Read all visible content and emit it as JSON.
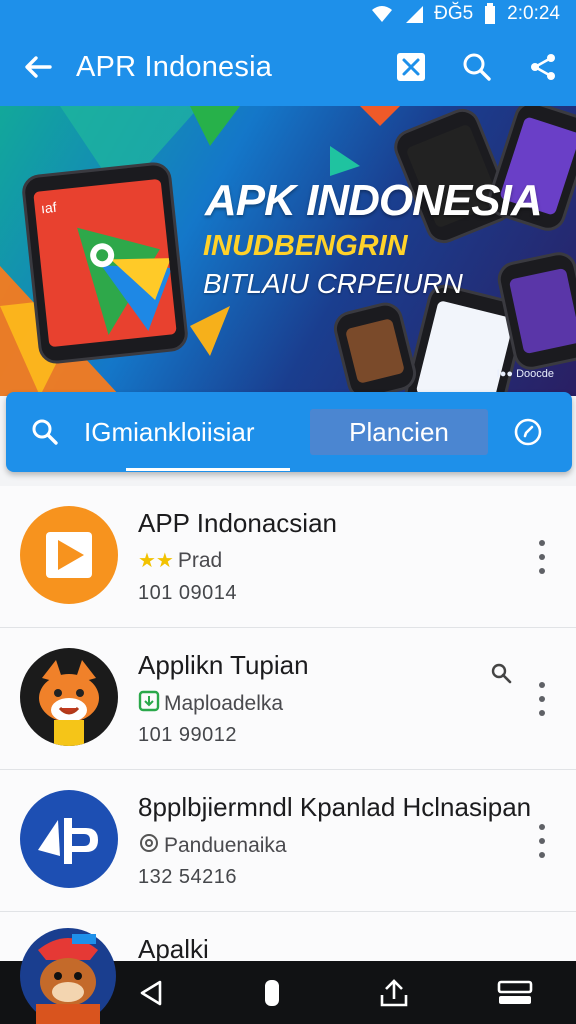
{
  "status_bar": {
    "network": "ÐĞ5",
    "time": "2:0:24"
  },
  "app_bar": {
    "title": "APR Indonesia",
    "icons": [
      "back-arrow-icon",
      "qr-scan-icon",
      "search-icon",
      "share-icon"
    ]
  },
  "banner": {
    "title": "APK INDONESIA",
    "subtitle_1": "INUDBENGRIN",
    "subtitle_2": "BITLAIU CRPEIURN",
    "tag": "I●● Doocde",
    "colors": {
      "start": "#12a89a",
      "mid": "#1477c9",
      "end": "#2a1f63",
      "yellow": "#ffd22a"
    }
  },
  "search": {
    "value": "IGmiankloiisiar",
    "button_label": "Plancien",
    "icons": [
      "search-icon",
      "compass-icon"
    ]
  },
  "apps": [
    {
      "name": "APP  Indonacsian",
      "meta": "Prad",
      "meta_icon": "star-rating-icon",
      "stars": 2,
      "count": "101  09014",
      "avatar": "play-logo"
    },
    {
      "name": "Applikn Tupian",
      "meta": "Maploadelka",
      "meta_icon": "download-badge-icon",
      "count": "101  99012",
      "avatar": "fox-mascot"
    },
    {
      "name": "8pplbjiermndl Kpanlad Hclnasipan",
      "meta": "Panduenaika",
      "meta_icon": "gear-badge-icon",
      "count": "132  54216",
      "avatar": "ap-logo"
    },
    {
      "name": "Apalki",
      "avatar": "mascot"
    }
  ],
  "nav_bar": {
    "icons": [
      "back-triangle-icon",
      "home-pill-icon",
      "upload-icon",
      "recents-icon"
    ]
  },
  "colors": {
    "primary": "#1e90ea",
    "secondary_button": "#4b86d1",
    "list_bg": "#fbfbfc",
    "nav_bg": "#111214"
  }
}
